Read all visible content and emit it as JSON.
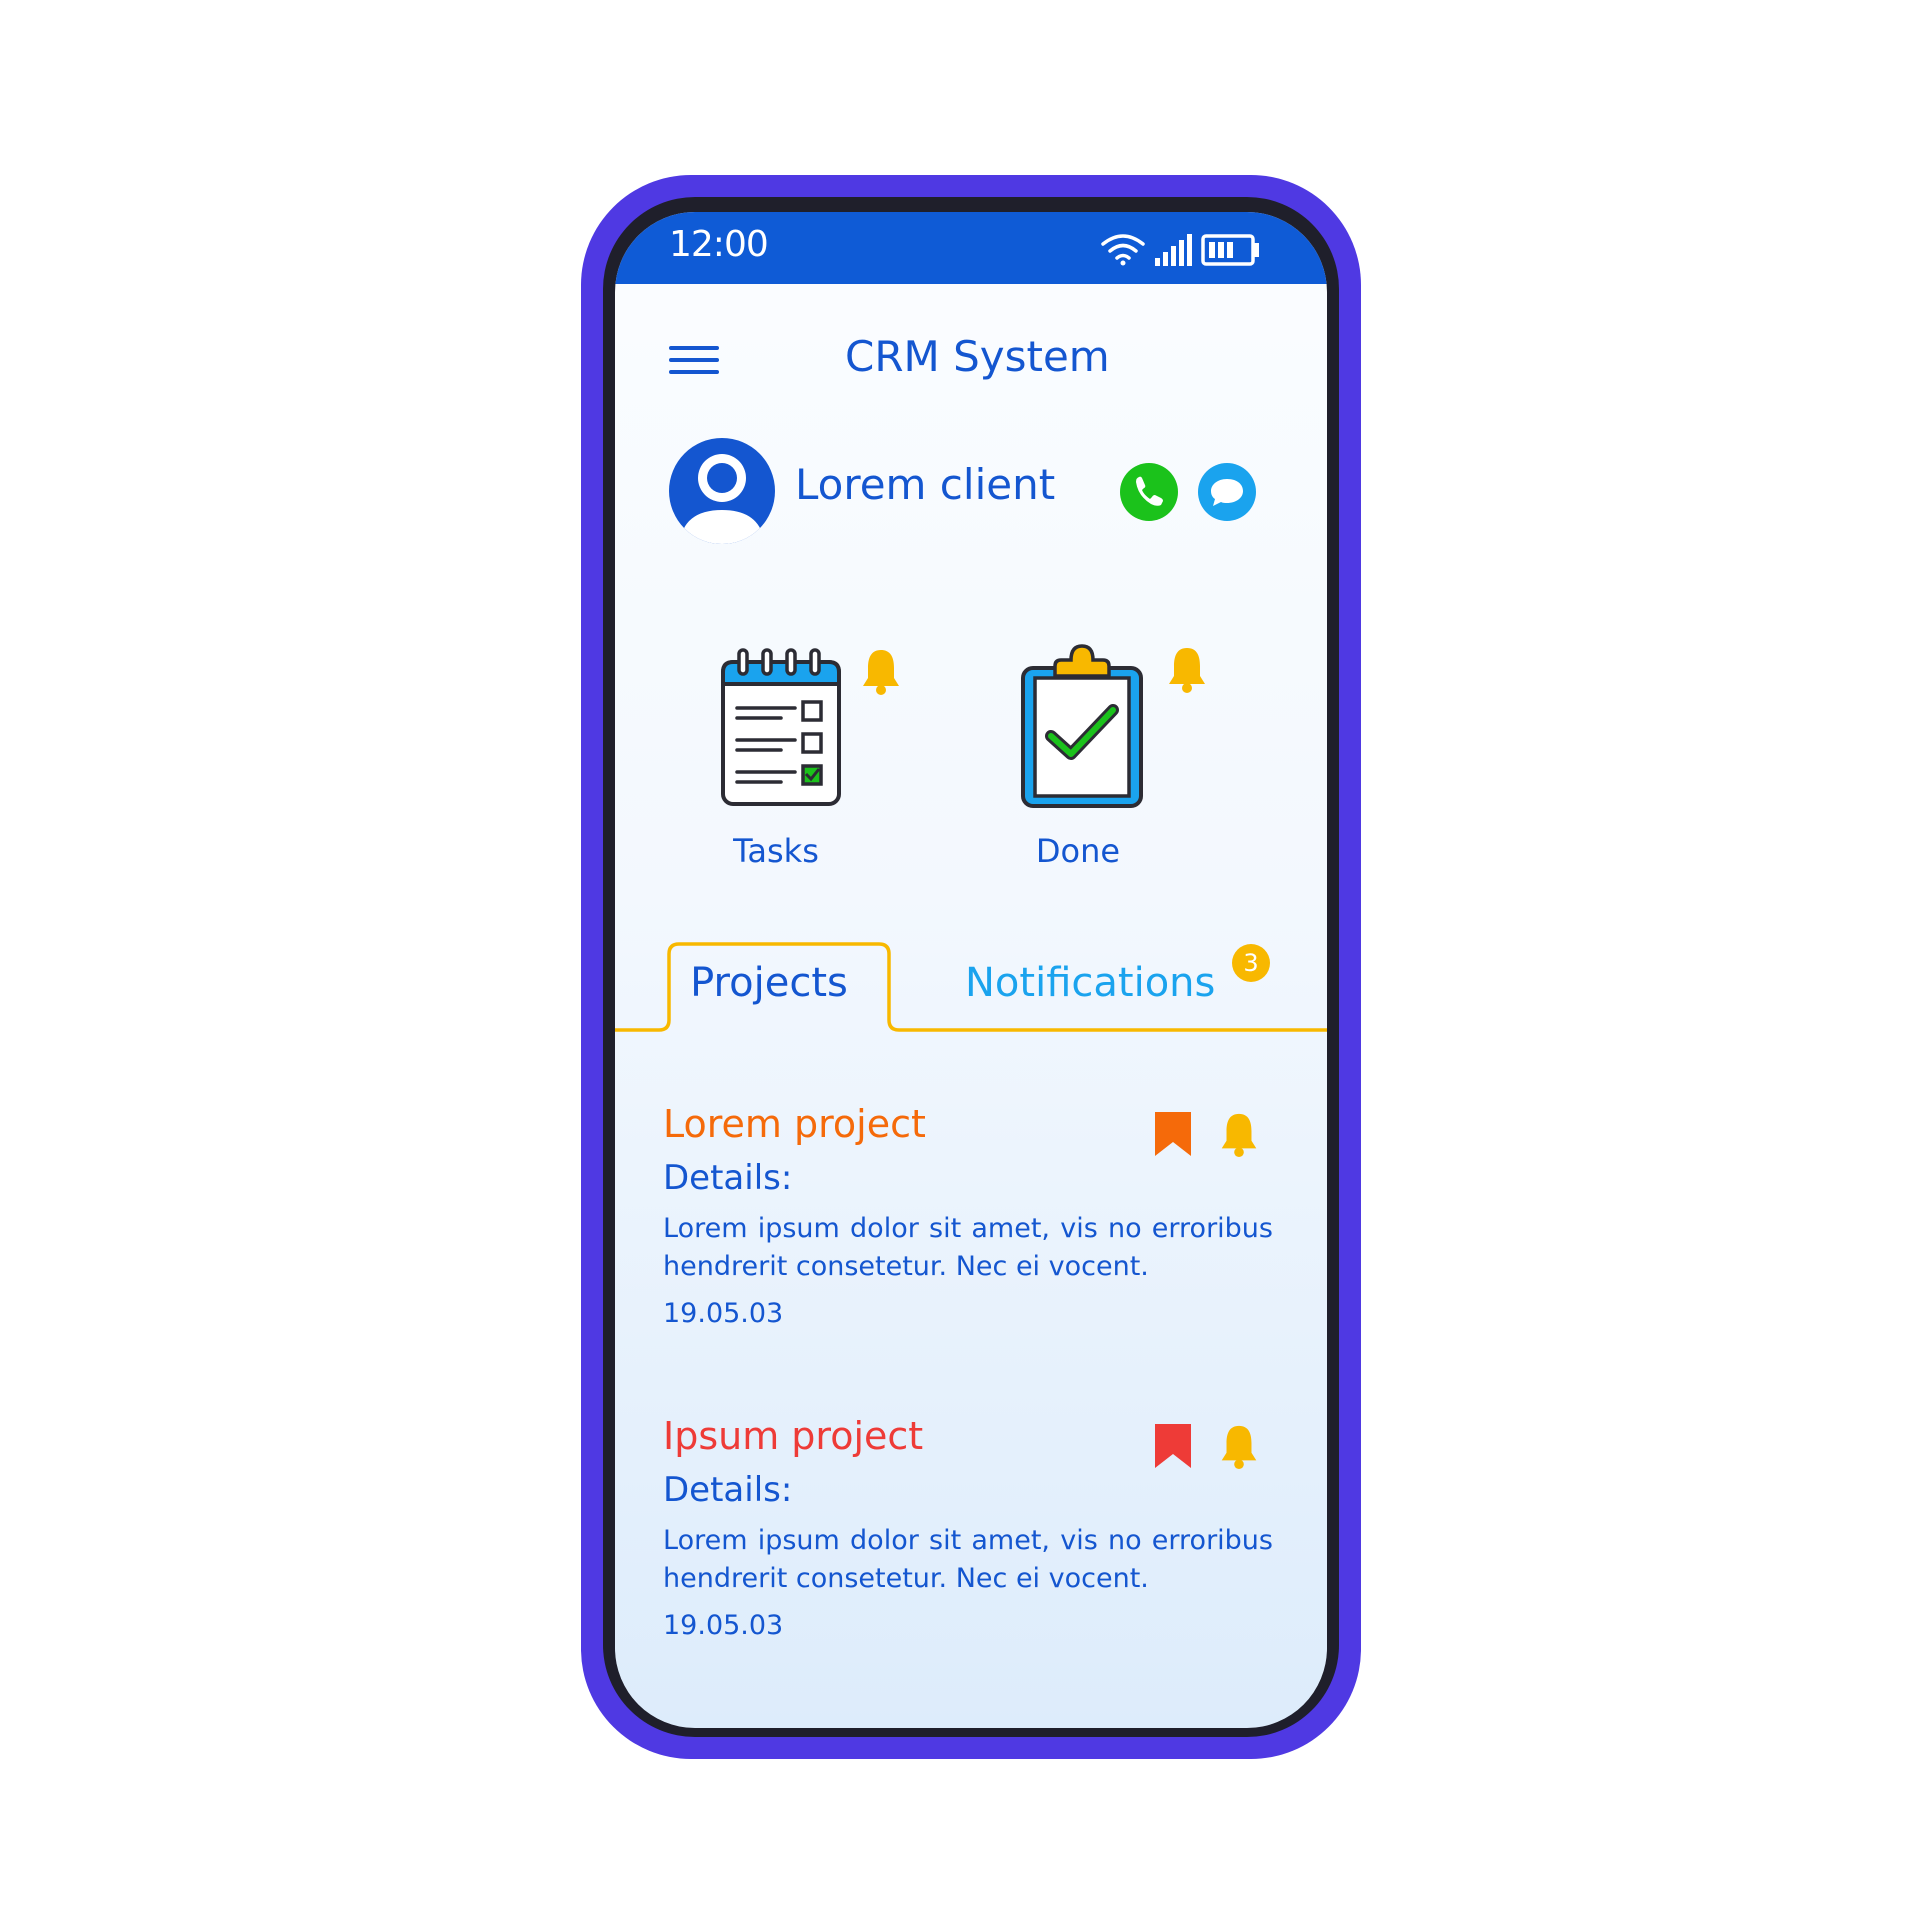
{
  "status_bar": {
    "time": "12:00"
  },
  "header": {
    "title": "CRM System"
  },
  "client": {
    "name": "Lorem client"
  },
  "shortcuts": {
    "tasks_label": "Tasks",
    "done_label": "Done"
  },
  "tabs": [
    {
      "label": "Projects",
      "active": true
    },
    {
      "label": "Notifications",
      "active": false,
      "badge": "3"
    }
  ],
  "projects": [
    {
      "title": "Lorem project",
      "title_color": "#f56a0a",
      "details_label": "Details:",
      "description": "Lorem ipsum dolor sit amet, vis no erroribus hendrerit consetetur. Nec ei vocent.",
      "date": "19.05.03",
      "bookmark_color": "#f56a0a"
    },
    {
      "title": "Ipsum project",
      "title_color": "#ee3b37",
      "details_label": "Details:",
      "description": "Lorem ipsum dolor sit amet, vis no erroribus hendrerit consetetur. Nec ei vocent.",
      "date": "19.05.03",
      "bookmark_color": "#ee3b37"
    }
  ],
  "colors": {
    "phone_frame": "#4f39e3",
    "status_bar": "#0f5bd6",
    "primary_text": "#1456d0",
    "accent_cyan": "#1aa3ee",
    "bell_yellow": "#f8b800",
    "call_green": "#1bc21b"
  },
  "icons": [
    "wifi-icon",
    "signal-icon",
    "battery-icon",
    "menu-icon",
    "avatar-icon",
    "phone-icon",
    "chat-icon",
    "tasks-icon",
    "done-clipboard-icon",
    "bell-icon",
    "bookmark-icon"
  ]
}
